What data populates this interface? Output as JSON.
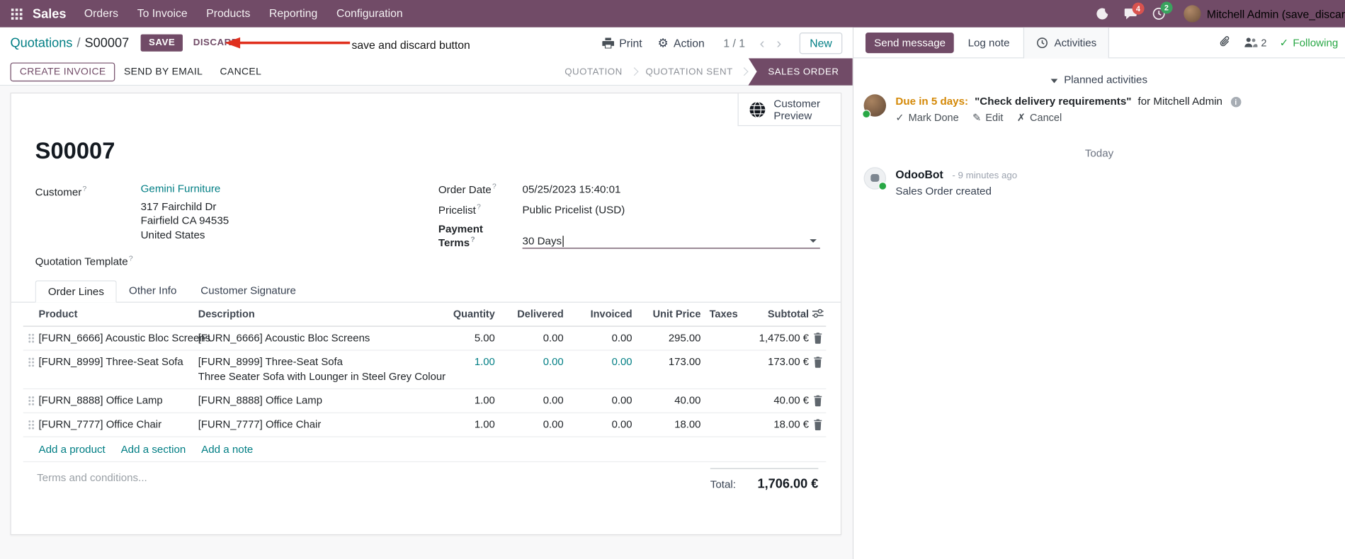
{
  "annotation": {
    "label": "save and discard button",
    "color": "#e0301e"
  },
  "nav": {
    "app_name": "Sales",
    "menus": [
      "Orders",
      "To Invoice",
      "Products",
      "Reporting",
      "Configuration"
    ],
    "message_badge": "4",
    "activity_badge": "2",
    "user": "Mitchell Admin (save_discar"
  },
  "control_panel": {
    "breadcrumb_parent": "Quotations",
    "breadcrumb_sep": "/",
    "breadcrumb_current": "S00007",
    "save": "SAVE",
    "discard": "DISCARD",
    "print": "Print",
    "action": "Action",
    "pager": "1 / 1",
    "new": "New"
  },
  "statusbar": {
    "create_invoice": "CREATE INVOICE",
    "send_by_email": "SEND BY EMAIL",
    "cancel": "CANCEL",
    "states": [
      "QUOTATION",
      "QUOTATION SENT",
      "SALES ORDER"
    ],
    "active_state": "SALES ORDER"
  },
  "ui": {
    "help_marker": "?"
  },
  "sheet": {
    "customer_preview": "Customer Preview",
    "title": "S00007",
    "customer_label": "Customer",
    "customer_name": "Gemini Furniture",
    "customer_address": [
      "317 Fairchild Dr",
      "Fairfield CA 94535",
      "United States"
    ],
    "quotation_template_label": "Quotation Template",
    "order_date_label": "Order Date",
    "order_date": "05/25/2023 15:40:01",
    "pricelist_label": "Pricelist",
    "pricelist": "Public Pricelist (USD)",
    "payment_terms_label": "Payment Terms",
    "payment_terms": "30 Days",
    "tabs": [
      "Order Lines",
      "Other Info",
      "Customer Signature"
    ],
    "columns": [
      "Product",
      "Description",
      "Quantity",
      "Delivered",
      "Invoiced",
      "Unit Price",
      "Taxes",
      "Subtotal"
    ],
    "rows": [
      {
        "product": "[FURN_6666] Acoustic Bloc Screens",
        "description": "[FURN_6666] Acoustic Bloc Screens",
        "description2": "",
        "quantity": "5.00",
        "delivered": "0.00",
        "invoiced": "0.00",
        "unit_price": "295.00",
        "taxes": "",
        "subtotal": "1,475.00 €"
      },
      {
        "product": "[FURN_8999] Three-Seat Sofa",
        "description": "[FURN_8999] Three-Seat Sofa",
        "description2": "Three Seater Sofa with Lounger in Steel Grey Colour",
        "quantity": "1.00",
        "delivered": "0.00",
        "invoiced": "0.00",
        "unit_price": "173.00",
        "taxes": "",
        "subtotal": "173.00 €",
        "edited": true
      },
      {
        "product": "[FURN_8888] Office Lamp",
        "description": "[FURN_8888] Office Lamp",
        "description2": "",
        "quantity": "1.00",
        "delivered": "0.00",
        "invoiced": "0.00",
        "unit_price": "40.00",
        "taxes": "",
        "subtotal": "40.00 €"
      },
      {
        "product": "[FURN_7777] Office Chair",
        "description": "[FURN_7777] Office Chair",
        "description2": "",
        "quantity": "1.00",
        "delivered": "0.00",
        "invoiced": "0.00",
        "unit_price": "18.00",
        "taxes": "",
        "subtotal": "18.00 €"
      }
    ],
    "add_product": "Add a product",
    "add_section": "Add a section",
    "add_note": "Add a note",
    "terms_placeholder": "Terms and conditions...",
    "total_label": "Total:",
    "total_value": "1,706.00 €"
  },
  "chatter": {
    "send_message": "Send message",
    "log_note": "Log note",
    "activities_tab": "Activities",
    "followers": "2",
    "following": "Following",
    "planned_activities": "Planned activities",
    "activity": {
      "due": "Due in 5 days:",
      "summary": "\"Check delivery requirements\"",
      "assignee": "for Mitchell Admin",
      "mark_done": "Mark Done",
      "edit": "Edit",
      "cancel": "Cancel"
    },
    "date_divider": "Today",
    "message": {
      "author": "OdooBot",
      "time": "- 9 minutes ago",
      "body": "Sales Order created"
    }
  },
  "colors": {
    "primary": "#714B67",
    "link": "#017e84",
    "annotation_red": "#e0301e",
    "due_soon_orange": "#d48806",
    "following_green": "#28a745"
  }
}
